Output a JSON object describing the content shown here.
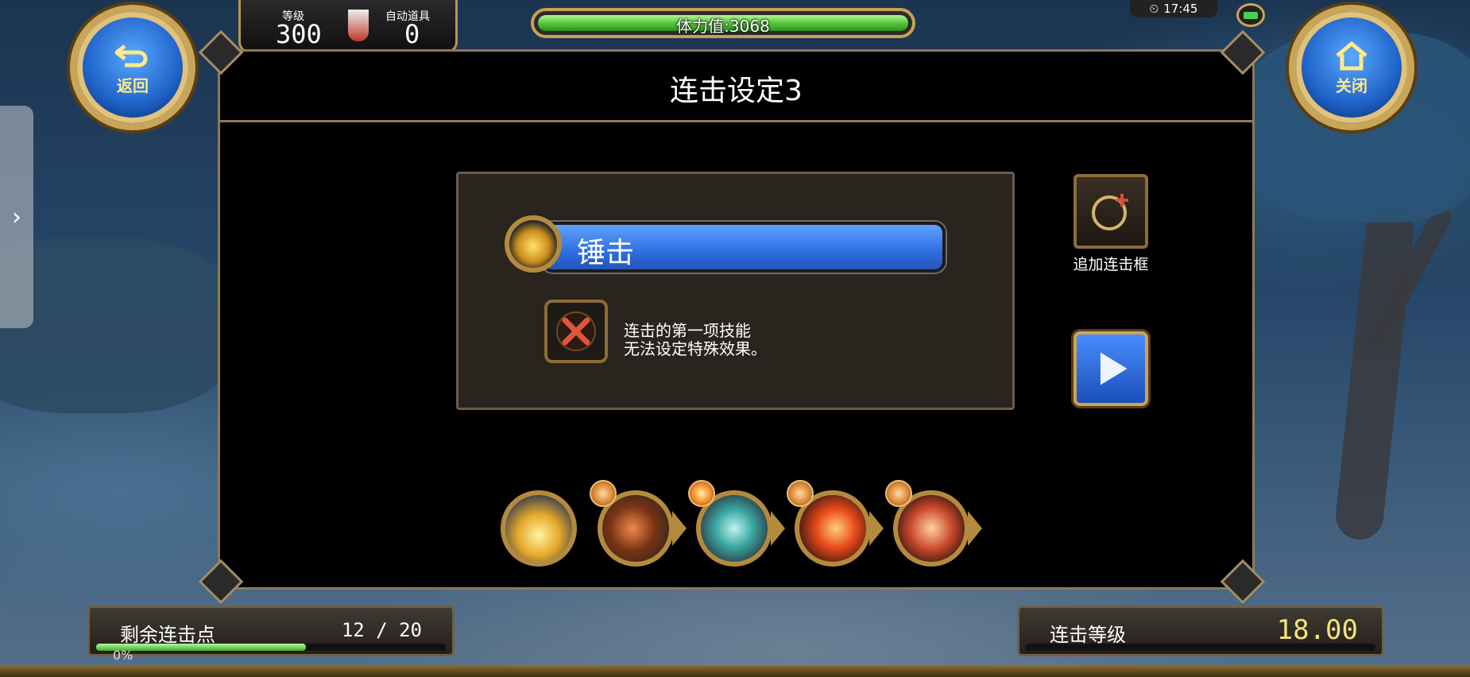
{
  "hud": {
    "back_label": "返回",
    "close_label": "关闭",
    "level_label": "等级",
    "level_value": "300",
    "auto_item_label": "自动道具",
    "auto_item_value": "0",
    "stamina_text": "体力值:3068",
    "clock": "17:45",
    "exp_percent": "0%"
  },
  "dialog": {
    "title": "连击设定3",
    "selected_skill": {
      "name": "锤击",
      "icon": "hammer-strike-icon"
    },
    "effect_note": {
      "line1": "连击的第一项技能",
      "line2": "无法设定特殊效果。"
    },
    "add_combo_label": "追加连击框",
    "chain": [
      {
        "icon": "hammer-strike-icon",
        "badge": null
      },
      {
        "icon": "axe-swing-icon",
        "badge": "fist-badge-icon"
      },
      {
        "icon": "spirit-figure-icon",
        "badge": "burst-badge-icon"
      },
      {
        "icon": "flame-slash-icon",
        "badge": "fist-badge-icon"
      },
      {
        "icon": "dome-shield-icon",
        "badge": "fist-badge-icon"
      }
    ]
  },
  "bottom": {
    "points_label": "剩余连击点",
    "points_value": "12 / 20",
    "points_fraction": 0.6,
    "combo_level_label": "连击等级",
    "combo_level_value": "18.00"
  },
  "colors": {
    "gold": "#c9a55a",
    "skill_bar_blue": "#2f6fe0",
    "stamina_green": "#56c93c",
    "combo_level_yellow": "#f3e27a"
  }
}
